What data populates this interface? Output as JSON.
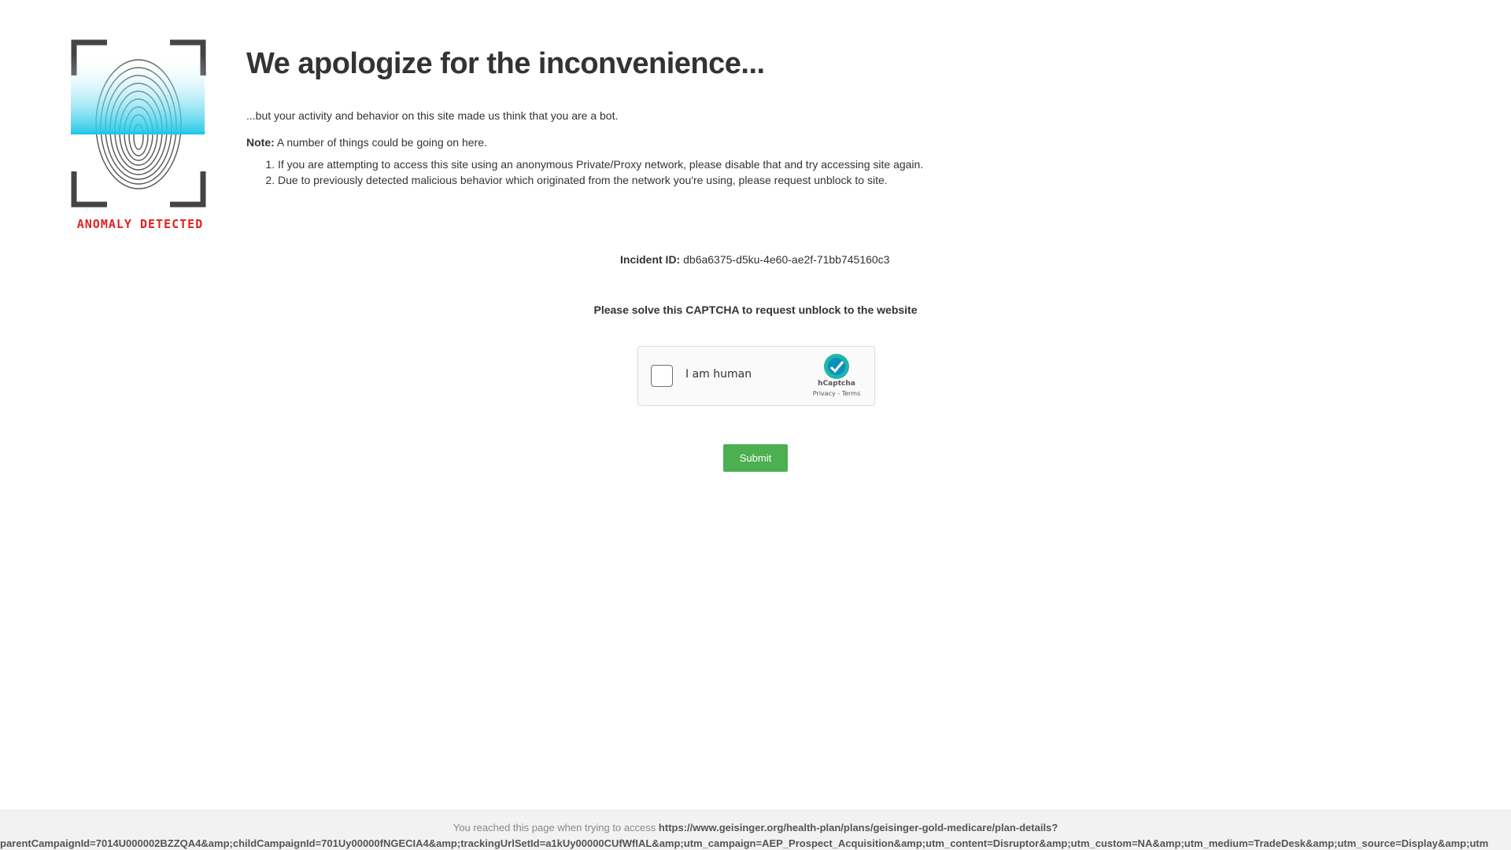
{
  "logo": {
    "badge_text": "ANOMALY DETECTED",
    "badge_color": "#e02020",
    "scan_color": "#1ec6e8"
  },
  "main": {
    "title": "We apologize for the inconvenience...",
    "intro": "...but your activity and behavior on this site made us think that you are a bot.",
    "note_label": "Note:",
    "note_text": "A number of things could be going on here.",
    "reasons": [
      "If you are attempting to access this site using an anonymous Private/Proxy network, please disable that and try accessing site again.",
      "Due to previously detected malicious behavior which originated from the network you're using, please request unblock to site."
    ]
  },
  "incident": {
    "label": "Incident ID:",
    "value": "db6a6375-d5ku-4e60-ae2f-71bb745160c3"
  },
  "captcha": {
    "prompt": "Please solve this CAPTCHA to request unblock to the website",
    "checkbox_label": "I am human",
    "provider": "hCaptcha",
    "privacy": "Privacy",
    "separator": " - ",
    "terms": "Terms",
    "accent_color": "#1fb6a8"
  },
  "submit_label": "Submit",
  "submit_color": "#4caf50",
  "footer": {
    "prefix": "You reached this page when trying to access",
    "url_line1": "https://www.geisinger.org/health-plan/plans/geisinger-gold-medicare/plan-details?",
    "url_line2": "parentCampaignId=7014U000002BZZQA4&amp;childCampaignId=701Uy00000fNGECIA4&amp;trackingUrlSetId=a1kUy00000CUfWfIAL&amp;utm_campaign=AEP_Prospect_Acquisition&amp;utm_content=Disruptor&amp;utm_custom=NA&amp;utm_medium=TradeDesk&amp;utm_source=Display&amp;utm"
  }
}
